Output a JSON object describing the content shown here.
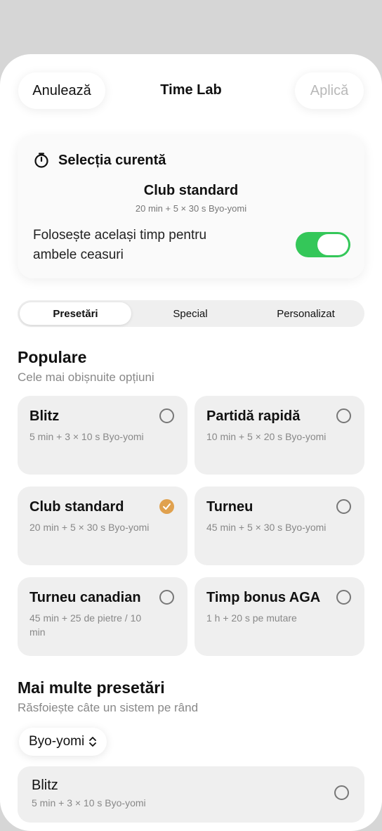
{
  "header": {
    "cancel_label": "Anulează",
    "title": "Time Lab",
    "apply_label": "Aplică"
  },
  "current": {
    "heading": "Selecția curentă",
    "name": "Club standard",
    "detail": "20 min + 5 × 30 s Byo-yomi",
    "toggle_label": "Folosește același timp pentru ambele ceasuri",
    "toggle_on": true
  },
  "tabs": [
    {
      "label": "Presetări",
      "active": true
    },
    {
      "label": "Special",
      "active": false
    },
    {
      "label": "Personalizat",
      "active": false
    }
  ],
  "popular": {
    "title": "Populare",
    "subtitle": "Cele mai obișnuite opțiuni",
    "presets": [
      {
        "name": "Blitz",
        "detail": "5 min + 3 × 10 s Byo-yomi",
        "selected": false
      },
      {
        "name": "Partidă rapidă",
        "detail": "10 min + 5 × 20 s Byo-yomi",
        "selected": false
      },
      {
        "name": "Club standard",
        "detail": "20 min + 5 × 30 s Byo-yomi",
        "selected": true
      },
      {
        "name": "Turneu",
        "detail": "45 min + 5 × 30 s Byo-yomi",
        "selected": false
      },
      {
        "name": "Turneu canadian",
        "detail": "45 min + 25 de pietre / 10 min",
        "selected": false
      },
      {
        "name": "Timp bonus AGA",
        "detail": "1 h + 20 s pe mutare",
        "selected": false
      }
    ]
  },
  "more": {
    "title": "Mai multe presetări",
    "subtitle": "Răsfoiește câte un sistem pe rând",
    "system_select": "Byo-yomi",
    "items": [
      {
        "name": "Blitz",
        "detail": "5 min + 3 × 10 s Byo-yomi",
        "selected": false
      }
    ]
  },
  "colors": {
    "toggle_on": "#34c759",
    "selected_radio": "#e0a14e",
    "apply_disabled": "#b8b8b8"
  }
}
